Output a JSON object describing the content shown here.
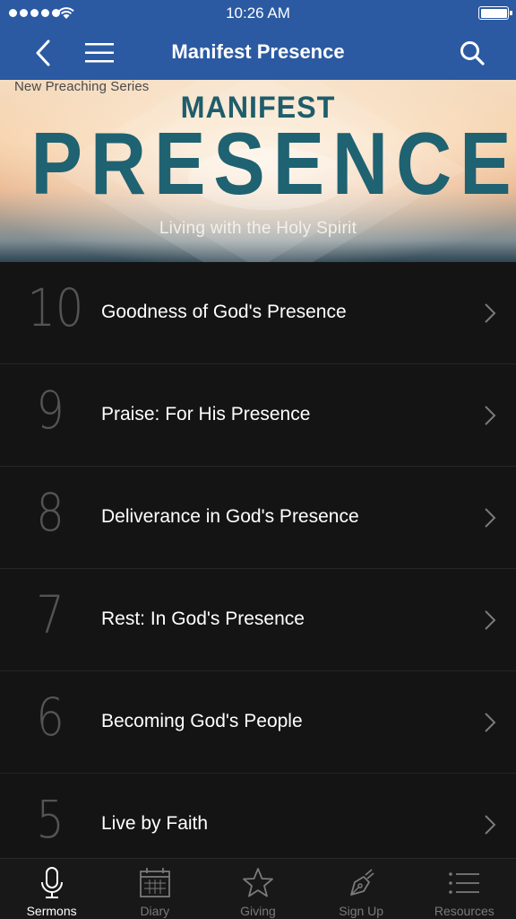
{
  "status_bar": {
    "time": "10:26 AM"
  },
  "nav": {
    "title": "Manifest Presence",
    "icons": [
      "back-chevron-icon",
      "hamburger-menu-icon",
      "search-icon"
    ]
  },
  "banner": {
    "series_label": "New Preaching Series",
    "title_small": "MANIFEST",
    "title_big": "PRESENCE",
    "subtitle": "Living with the Holy Spirit"
  },
  "sermons": [
    {
      "number": "10",
      "title": "Goodness of God's Presence"
    },
    {
      "number": "9",
      "title": "Praise: For His Presence"
    },
    {
      "number": "8",
      "title": "Deliverance in God's Presence"
    },
    {
      "number": "7",
      "title": "Rest: In God's Presence"
    },
    {
      "number": "6",
      "title": "Becoming God's People"
    },
    {
      "number": "5",
      "title": "Live by Faith"
    }
  ],
  "tabs": [
    {
      "label": "Sermons",
      "icon": "microphone-icon",
      "active": true
    },
    {
      "label": "Diary",
      "icon": "calendar-icon",
      "active": false
    },
    {
      "label": "Giving",
      "icon": "star-icon",
      "active": false
    },
    {
      "label": "Sign Up",
      "icon": "pen-nib-icon",
      "active": false
    },
    {
      "label": "Resources",
      "icon": "list-icon",
      "active": false
    }
  ],
  "colors": {
    "nav_blue": "#2b5aa2",
    "list_background": "#141414",
    "banner_title_teal": "#1f6271"
  }
}
